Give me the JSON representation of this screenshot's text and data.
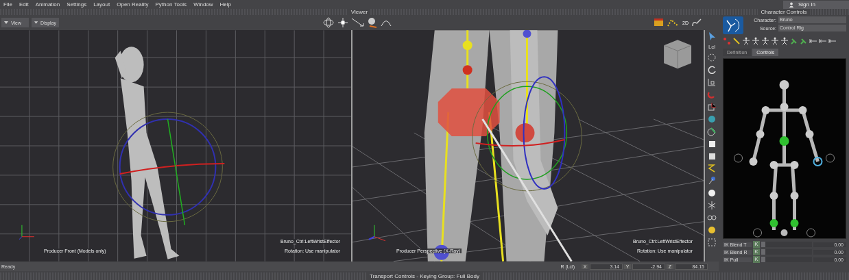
{
  "menu": [
    "File",
    "Edit",
    "Animation",
    "Settings",
    "Layout",
    "Open Reality",
    "Python Tools",
    "Window",
    "Help"
  ],
  "sign_in": "Sign In",
  "viewer": {
    "title": "Viewer",
    "view_buttons": [
      "View",
      "Display"
    ],
    "twod_label": "2D",
    "lcl_label": "Lcl",
    "panes": [
      {
        "kind": "front",
        "camera": "Producer Front (Models only)",
        "selection": "Bruno_Ctrl:LeftWristEffector",
        "mode": "Rotation: Use manipulator"
      },
      {
        "kind": "perspective",
        "camera": "Producer Perspective (X-Ray)",
        "selection": "Bruno_Ctrl:LeftWristEffector",
        "mode": "Rotation: Use manipulator"
      }
    ]
  },
  "status": {
    "text": "Ready",
    "field_label": "R (Lcl)",
    "coords": [
      {
        "axis": "X",
        "value": "3.14"
      },
      {
        "axis": "Y",
        "value": "-2.94"
      },
      {
        "axis": "Z",
        "value": "84.15"
      }
    ]
  },
  "character_controls": {
    "title": "Character Controls",
    "character_label": "Character:",
    "character": "Bruno",
    "source_label": "Source:",
    "source": "Control Rig",
    "tabs": [
      {
        "label": "Definition",
        "selected": false
      },
      {
        "label": "Controls",
        "selected": true
      }
    ],
    "properties": [
      {
        "name": "IK Blend T",
        "key": "K",
        "value": "0.00",
        "level": 0
      },
      {
        "name": "IK Blend R",
        "key": "K",
        "value": "0.00",
        "level": 0
      },
      {
        "name": "IK Pull",
        "key": "K",
        "value": "0.00",
        "level": 0
      }
    ]
  },
  "transport": "Transport Controls - Keying Group: Full Body"
}
